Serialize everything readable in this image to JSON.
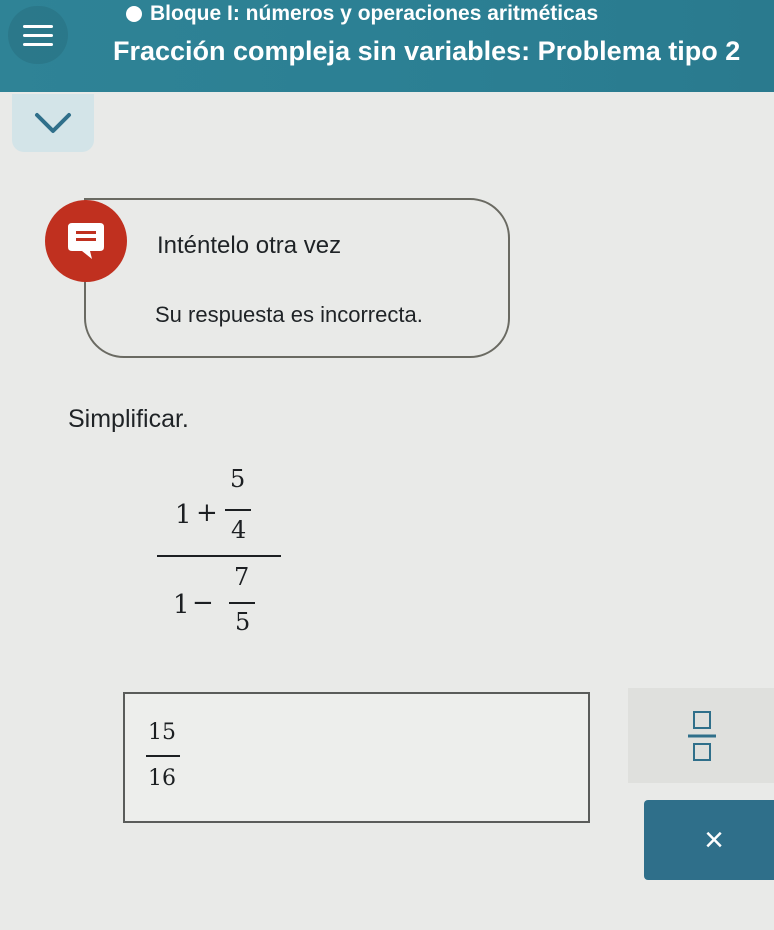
{
  "header": {
    "block_title": "Bloque I: números y operaciones aritméticas",
    "problem_title": "Fracción compleja sin variables: Problema tipo 2"
  },
  "icons": {
    "menu": "hamburger-menu-icon",
    "status": "status-dot-icon",
    "collapse": "chevron-down-icon",
    "feedback": "chat-bubble-icon",
    "fraction_tool": "fraction-template-icon",
    "clear": "close-icon"
  },
  "feedback": {
    "title": "Inténtelo otra vez",
    "message": "Su respuesta es incorrecta."
  },
  "problem": {
    "instruction": "Simplificar.",
    "numerator_whole": "1",
    "numerator_op": "+",
    "numerator_frac_num": "5",
    "numerator_frac_den": "4",
    "denominator_whole": "1",
    "denominator_op": "−",
    "denominator_frac_num": "7",
    "denominator_frac_den": "5"
  },
  "answer": {
    "numerator": "15",
    "denominator": "16"
  },
  "toolbar": {
    "clear_label": "×"
  },
  "colors": {
    "header": "#2f8396",
    "feedback_icon": "#c0301f",
    "clear_button": "#2f6f8a",
    "chevron_bg": "#d3e4e8"
  }
}
